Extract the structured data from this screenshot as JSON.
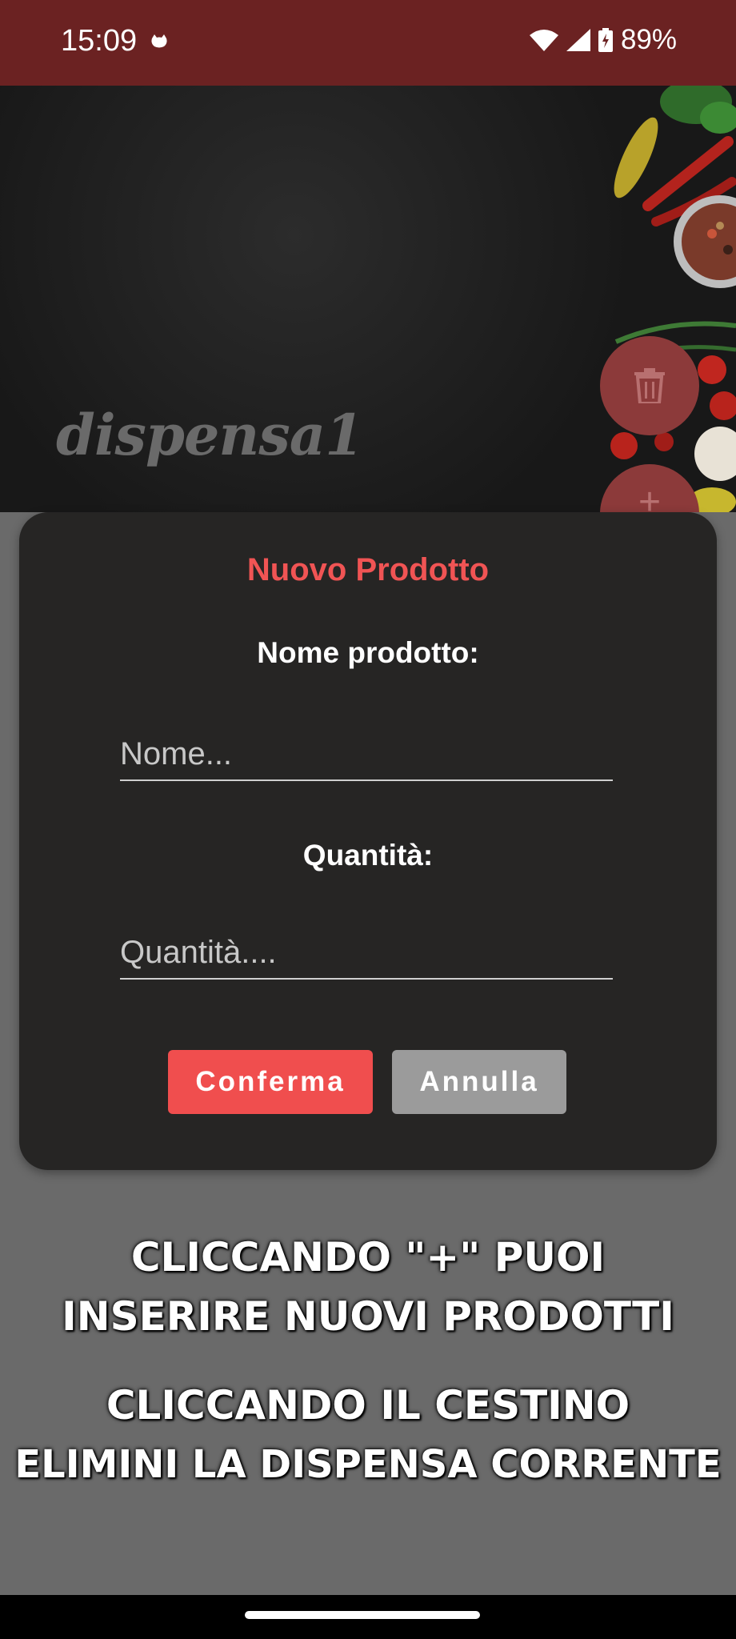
{
  "status_bar": {
    "time": "15:09",
    "battery": "89%",
    "icons": [
      "cat-notification-icon",
      "wifi-icon",
      "signal-icon",
      "battery-charging-icon"
    ]
  },
  "hero": {
    "brand": "dispensa1"
  },
  "fabs": {
    "delete_icon": "trash-icon",
    "add_label": "+"
  },
  "dialog": {
    "title": "Nuovo Prodotto",
    "name_label": "Nome prodotto:",
    "name_placeholder": "Nome...",
    "name_value": "",
    "qty_label": "Quantità:",
    "qty_placeholder": "Quantità....",
    "qty_value": "",
    "confirm_label": "Conferma",
    "cancel_label": "Annulla"
  },
  "captions": {
    "line1": "CLICCANDO \"+\" PUOI",
    "line2": "INSERIRE NUOVI PRODOTTI",
    "line3": "CLICCANDO IL CESTINO",
    "line4": "ELIMINI LA DISPENSA CORRENTE"
  },
  "colors": {
    "status_bar": "#6b2222",
    "accent": "#f04e4e",
    "dialog_bg": "#262524",
    "cancel_button": "#9b9b9b"
  }
}
